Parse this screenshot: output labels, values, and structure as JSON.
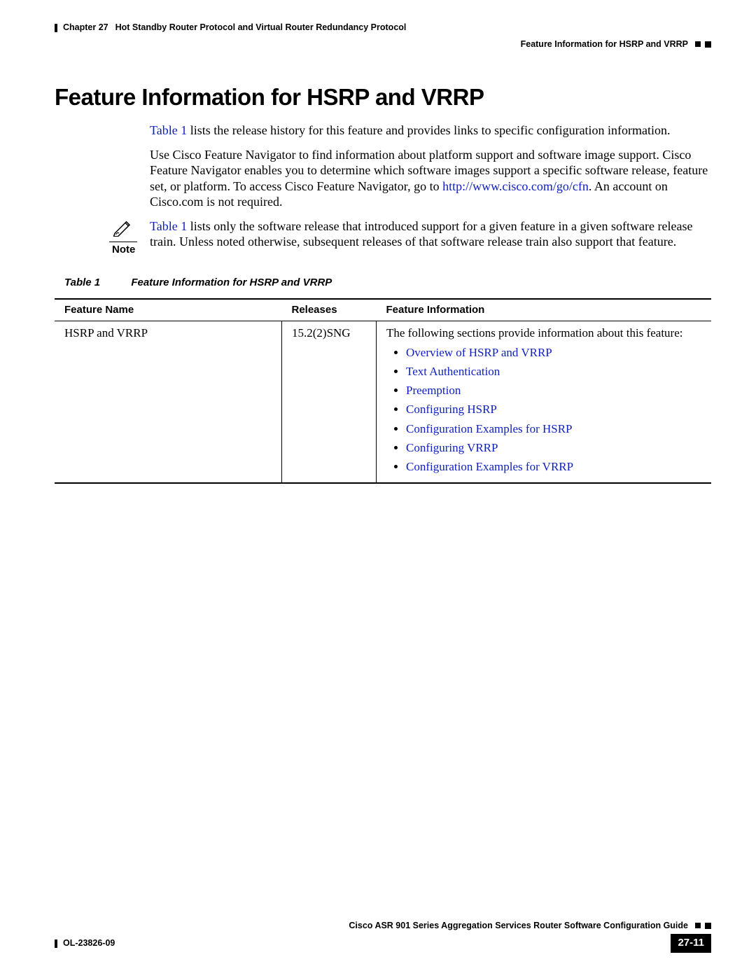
{
  "header": {
    "chapter_label": "Chapter 27",
    "chapter_title": "Hot Standby Router Protocol and Virtual Router Redundancy Protocol",
    "section_title": "Feature Information for HSRP and VRRP"
  },
  "main": {
    "title": "Feature Information for HSRP and VRRP",
    "intro_link": "Table 1",
    "intro_text_rest": " lists the release history for this feature and provides links to specific configuration information.",
    "para2_a": "Use Cisco Feature Navigator to find information about platform support and software image support. Cisco Feature Navigator enables you to determine which software images support a specific software release, feature set, or platform. To access Cisco Feature Navigator, go to ",
    "para2_link": "http://www.cisco.com/go/cfn",
    "para2_b": ". An account on Cisco.com is not required.",
    "note_label": "Note",
    "note_link": "Table 1",
    "note_text": " lists only the software release that introduced support for a given feature in a given software release train. Unless noted otherwise, subsequent releases of that software release train also support that feature."
  },
  "table": {
    "caption_ref": "Table 1",
    "caption_title": "Feature Information for HSRP and VRRP",
    "headers": {
      "c1": "Feature Name",
      "c2": "Releases",
      "c3": "Feature Information"
    },
    "row": {
      "feature_name": "HSRP and VRRP",
      "release": "15.2(2)SNG",
      "info_lead": "The following sections provide information about this feature:",
      "links": [
        "Overview of HSRP and VRRP",
        "Text Authentication",
        "Preemption",
        "Configuring HSRP",
        "Configuration Examples for HSRP",
        "Configuring VRRP",
        "Configuration Examples for VRRP"
      ]
    }
  },
  "footer": {
    "guide_title": "Cisco ASR 901 Series Aggregation Services Router Software Configuration Guide",
    "doc_id": "OL-23826-09",
    "page_number": "27-11"
  }
}
